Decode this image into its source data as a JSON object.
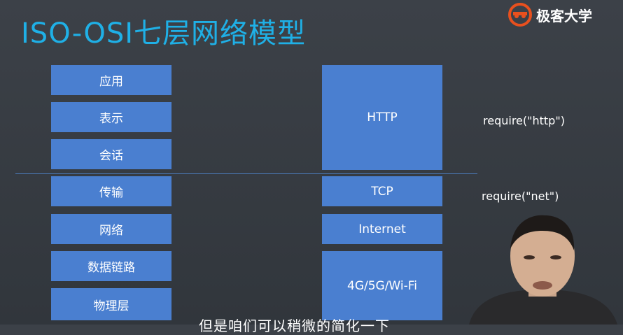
{
  "header": {
    "title": "ISO-OSI七层网络模型",
    "brand": "极客大学",
    "brand_icon": "geek-university-logo-icon"
  },
  "layers": [
    "应用",
    "表示",
    "会话",
    "传输",
    "网络",
    "数据链路",
    "物理层"
  ],
  "protocols": [
    "HTTP",
    "TCP",
    "Internet",
    "4G/5G/Wi-Fi"
  ],
  "notes": [
    "require(\"http\")",
    "require(\"net\")"
  ],
  "subtitle": "但是咱们可以稍微的简化一下",
  "colors": {
    "title": "#1fb0e6",
    "box": "#4a7fd0",
    "background": "#353a40"
  }
}
